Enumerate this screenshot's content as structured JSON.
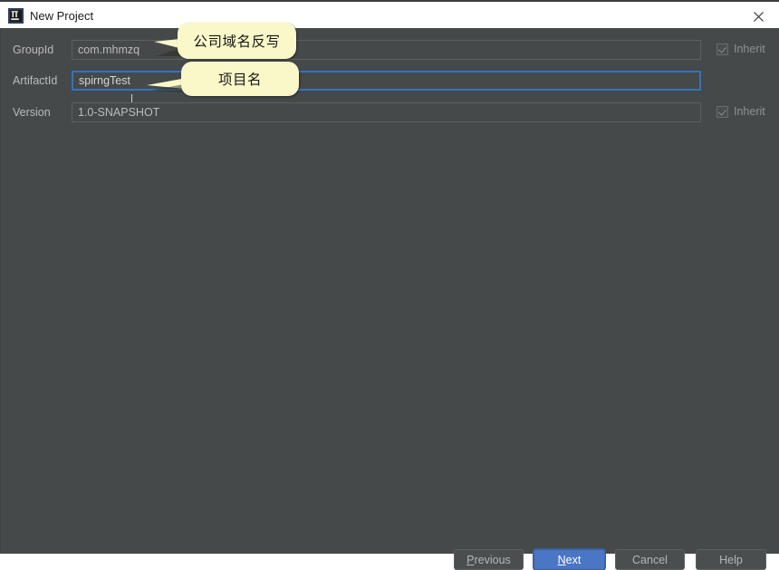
{
  "window": {
    "title": "New Project",
    "icon": "intellij-idea-icon",
    "close_icon": "close-icon",
    "background_color": "#45494A",
    "titlebar_color": "#FFFFFF"
  },
  "form": {
    "rows": [
      {
        "label": "GroupId",
        "value": "com.mhmzq",
        "placeholder": "",
        "focused": false,
        "inherit": {
          "label": "Inherit",
          "checked": true,
          "enabled": false
        }
      },
      {
        "label": "ArtifactId",
        "value": "spirngTest",
        "placeholder": "",
        "focused": true,
        "inherit": null
      },
      {
        "label": "Version",
        "value": "1.0-SNAPSHOT",
        "placeholder": "",
        "focused": false,
        "inherit": {
          "label": "Inherit",
          "checked": true,
          "enabled": false
        }
      }
    ]
  },
  "annotations": {
    "color": "#FAF8C8",
    "callouts": [
      {
        "text": "公司域名反写",
        "points_to": "GroupId"
      },
      {
        "text": "项目名",
        "points_to": "ArtifactId"
      }
    ]
  },
  "footer": {
    "buttons": [
      {
        "label": "Previous",
        "mnemonic": "P",
        "primary": false
      },
      {
        "label": "Next",
        "mnemonic": "N",
        "primary": true
      },
      {
        "label": "Cancel",
        "mnemonic": "",
        "primary": false
      },
      {
        "label": "Help",
        "mnemonic": "",
        "primary": false
      }
    ],
    "primary_color": "#4A76C4"
  }
}
